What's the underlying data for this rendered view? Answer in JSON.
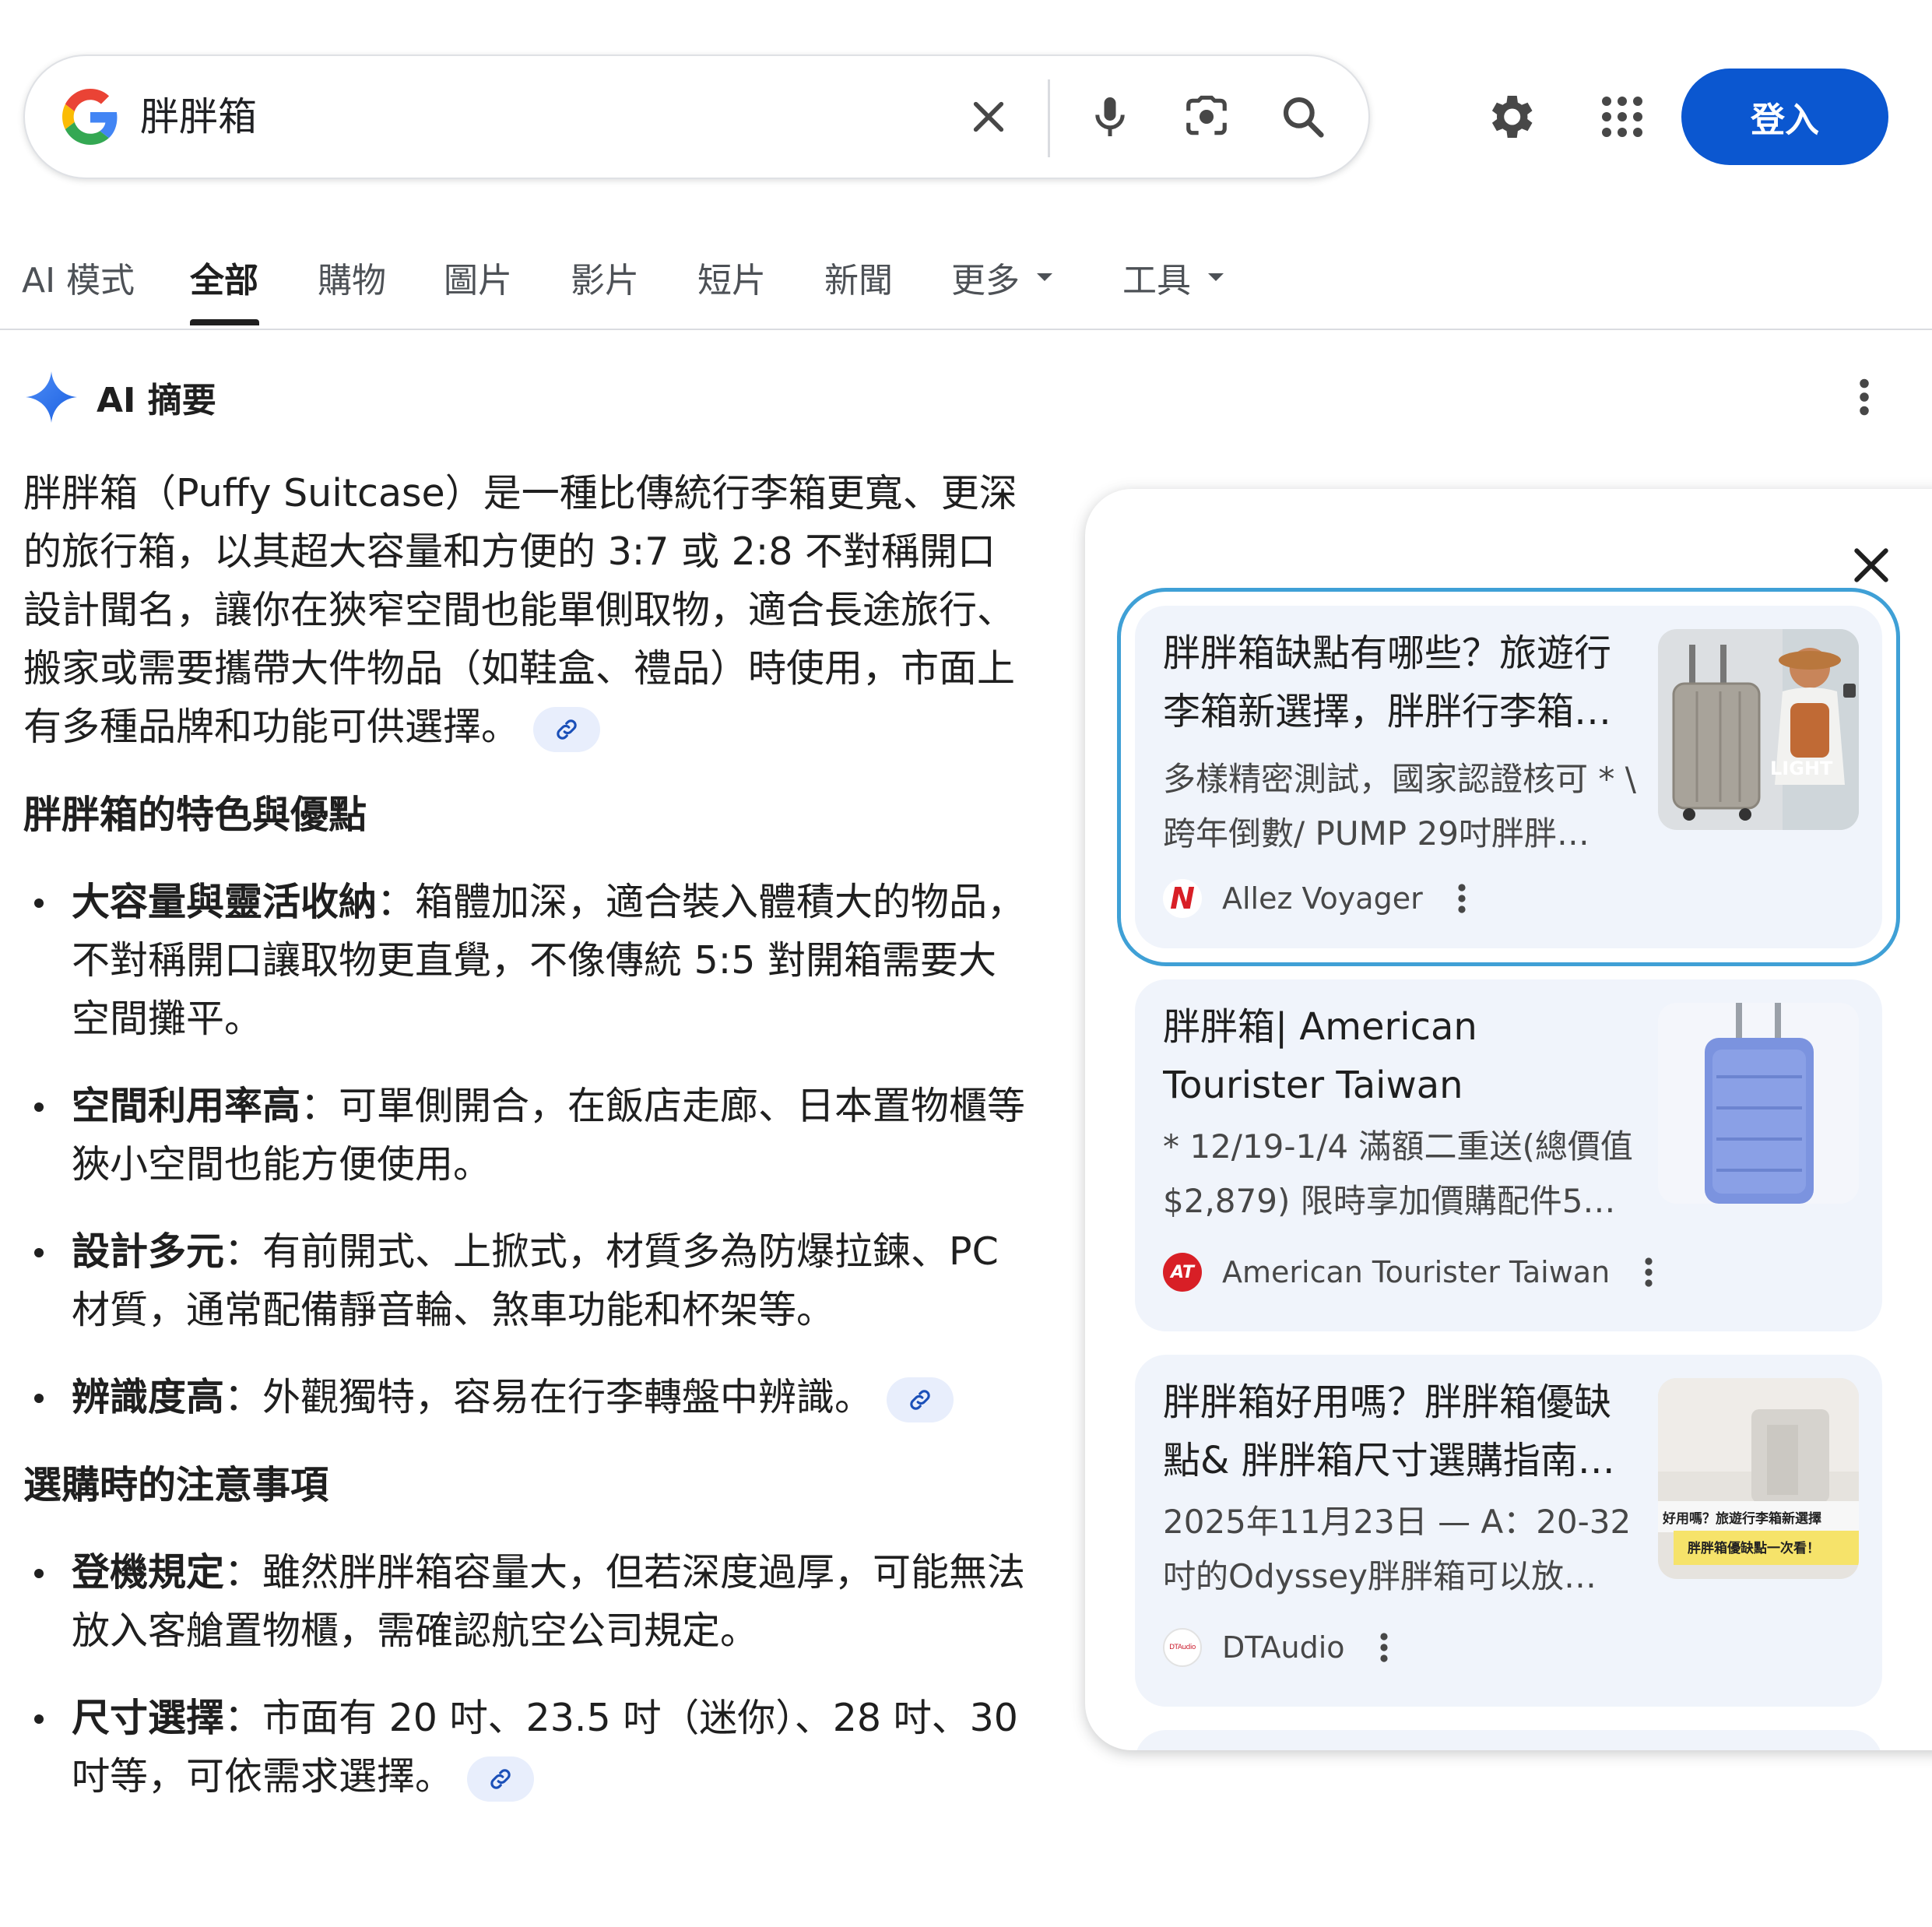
{
  "search": {
    "query": "胖胖箱",
    "signin_label": "登入"
  },
  "tabs": [
    {
      "label": "AI 模式"
    },
    {
      "label": "全部"
    },
    {
      "label": "購物"
    },
    {
      "label": "圖片"
    },
    {
      "label": "影片"
    },
    {
      "label": "短片"
    },
    {
      "label": "新聞"
    },
    {
      "label": "更多"
    },
    {
      "label": "工具"
    }
  ],
  "ai_overview": {
    "title": "AI 摘要",
    "intro": "胖胖箱（Puffy Suitcase）是一種比傳統行李箱更寬、更深的旅行箱，以其超大容量和方便的 3:7 或 2:8 不對稱開口設計聞名，讓你在狹窄空間也能單側取物，適合長途旅行、搬家或需要攜帶大件物品（如鞋盒、禮品）時使用，市面上有多種品牌和功能可供選擇。",
    "section1_heading": "胖胖箱的特色與優點",
    "features": [
      {
        "term": "大容量與靈活收納",
        "text": "：箱體加深，適合裝入體積大的物品，不對稱開口讓取物更直覺，不像傳統 5:5 對開箱需要大空間攤平。"
      },
      {
        "term": "空間利用率高",
        "text": "：可單側開合，在飯店走廊、日本置物櫃等狹小空間也能方便使用。"
      },
      {
        "term": "設計多元",
        "text": "：有前開式、上掀式，材質多為防爆拉鍊、PC材質，通常配備靜音輪、煞車功能和杯架等。"
      },
      {
        "term": "辨識度高",
        "text": "：外觀獨特，容易在行李轉盤中辨識。"
      }
    ],
    "section2_heading": "選購時的注意事項",
    "tips": [
      {
        "term": "登機規定",
        "text": "：雖然胖胖箱容量大，但若深度過厚，可能無法放入客艙置物櫃，需確認航空公司規定。"
      },
      {
        "term": "尺寸選擇",
        "text": "：市面有 20 吋、23.5 吋（迷你）、28 吋、30 吋等，可依需求選擇。"
      }
    ]
  },
  "sources": [
    {
      "title": "胖胖箱缺點有哪些？旅遊行李箱新選擇，胖胖行李箱…",
      "snippet": "多樣精密測試，國家認證核可 * \\ 跨年倒數/ PUMP 29吋胖胖…",
      "source": "Allez Voyager",
      "favicon_text": "N",
      "thumb_text": "LIGHT"
    },
    {
      "title": "胖胖箱| American Tourister Taiwan",
      "snippet": "* 12/19-1/4 滿額二重送(總價值 $2,879) 限時享加價購配件5…",
      "source": "American Tourister Taiwan",
      "favicon_text": "AT"
    },
    {
      "title": "胖胖箱好用嗎？胖胖箱優缺點& 胖胖箱尺寸選購指南…",
      "snippet": "2025年11月23日 — A：20-32 吋的Odyssey胖胖箱可以放…",
      "source": "DTAudio",
      "favicon_text": "DTAudio",
      "thumb_text_1": "好用嗎？旅遊行李箱新選擇",
      "thumb_text_2": "胖胖箱優缺點一次看！"
    }
  ],
  "colors": {
    "accent": "#0b57d0",
    "card_bg": "#f0f4fb",
    "selected_outline": "#3fa0d6"
  }
}
